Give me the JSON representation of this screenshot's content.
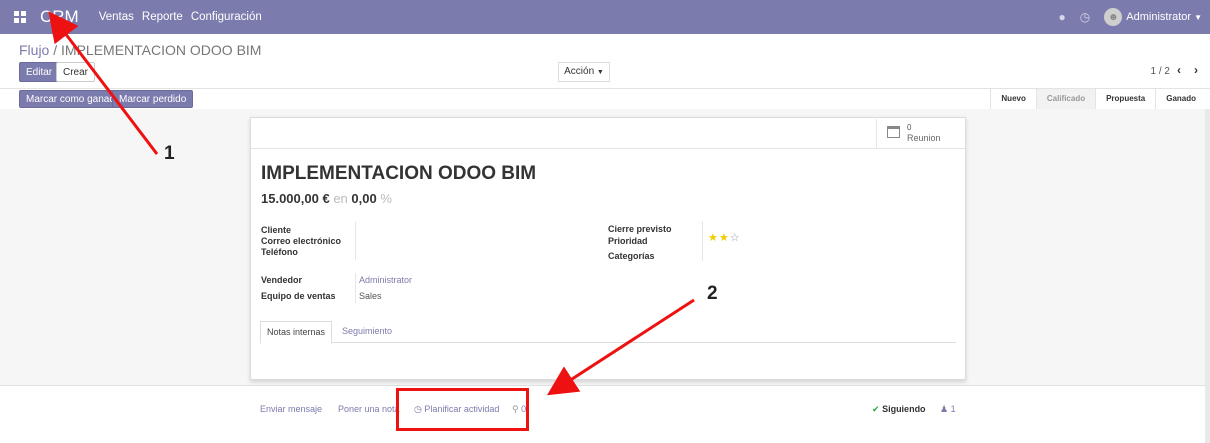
{
  "topbar": {
    "brand": "CRM",
    "menu": [
      "Ventas",
      "Reporte",
      "Configuración"
    ],
    "user": "Administrator",
    "accent": "#7c7bad"
  },
  "breadcrumb": {
    "parent": "Flujo",
    "separator": "/",
    "current": "IMPLEMENTACION ODOO BIM"
  },
  "buttons": {
    "edit": "Editar",
    "create": "Crear",
    "action": "Acción",
    "mark_won": "Marcar como ganado",
    "mark_lost": "Marcar perdido"
  },
  "pager": {
    "value": "1 / 2",
    "prev": "‹",
    "next": "›"
  },
  "stages": [
    "Nuevo",
    "Calificado",
    "Propuesta",
    "Ganado"
  ],
  "meeting": {
    "count": "0",
    "label": "Reunion"
  },
  "lead": {
    "title": "IMPLEMENTACION ODOO BIM",
    "revenue": "15.000,00 €",
    "en": "en",
    "probability": "0,00",
    "percent": "%",
    "fields": {
      "cliente": "Cliente",
      "correo": "Correo electrónico",
      "telefono": "Teléfono",
      "cierre": "Cierre previsto",
      "prioridad": "Prioridad",
      "categorias": "Categorías",
      "vendedor": "Vendedor",
      "vendedor_value": "Administrator",
      "equipo": "Equipo de ventas",
      "equipo_value": "Sales"
    },
    "priority": {
      "stars": 2,
      "max": 3
    },
    "star_full": "★",
    "star_empty": "☆"
  },
  "tabs": [
    "Notas internas",
    "Seguimiento"
  ],
  "chatter": {
    "send": "Enviar mensaje",
    "note": "Poner una nota",
    "activity": "Planificar actividad",
    "attachments": "0",
    "following": "Siguiendo",
    "followers": "1"
  },
  "annotations": {
    "one": "1",
    "two": "2",
    "color": "#e11111"
  }
}
